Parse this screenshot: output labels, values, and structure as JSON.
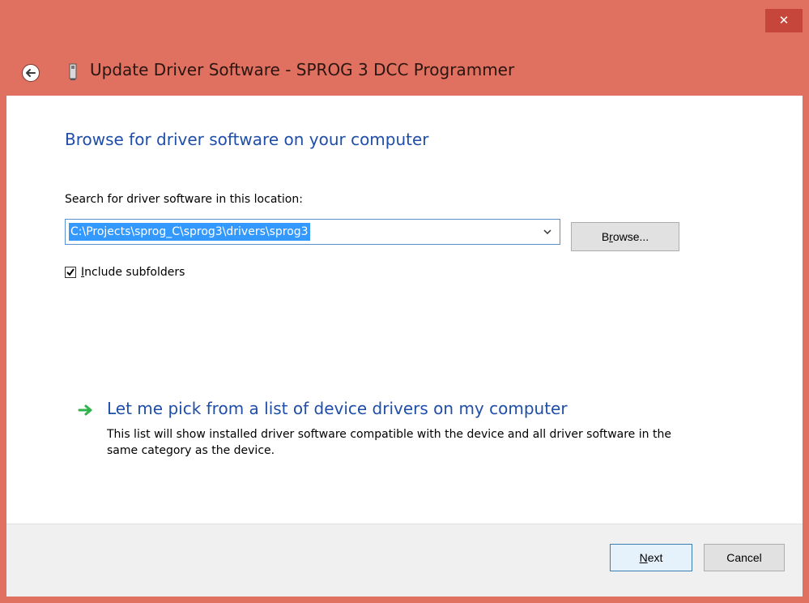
{
  "window": {
    "close_glyph": "✕",
    "title": "Update Driver Software - SPROG 3 DCC Programmer"
  },
  "content": {
    "heading": "Browse for driver software on your computer",
    "search_label": "Search for driver software in this location:",
    "path_value": "C:\\Projects\\sprog_C\\sprog3\\drivers\\sprog3",
    "browse": {
      "underline_char": "r",
      "before": "B",
      "after": "owse..."
    },
    "include_subfolders": {
      "checked": true,
      "underline_char": "I",
      "after": "nclude subfolders"
    },
    "pick": {
      "title": "Let me pick from a list of device drivers on my computer",
      "description": "This list will show installed driver software compatible with the device and all driver software in the same category as the device."
    }
  },
  "footer": {
    "next": {
      "underline_char": "N",
      "after": "ext"
    },
    "cancel_label": "Cancel"
  },
  "colors": {
    "titlebar": "#e0705f",
    "close": "#c7463b",
    "link_blue": "#1f4ea8",
    "selection": "#3399ff",
    "arrow_green": "#2fb34a"
  },
  "icons": {
    "back": "back-arrow-icon",
    "device": "usb-device-icon",
    "combo": "chevron-down-icon",
    "check": "checkmark-icon",
    "pick": "green-arrow-icon"
  }
}
